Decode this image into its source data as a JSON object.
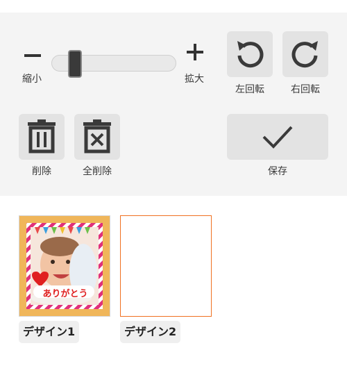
{
  "zoom": {
    "minus_symbol": "−",
    "plus_symbol": "+",
    "shrink_label": "縮小",
    "enlarge_label": "拡大",
    "level": 0.15
  },
  "rotate": {
    "left_label": "左回転",
    "right_label": "右回転"
  },
  "actions": {
    "delete_label": "削除",
    "delete_all_label": "全削除",
    "save_label": "保存"
  },
  "designs": [
    {
      "label": "デザイン1",
      "caption": "ありがとう",
      "selected": false
    },
    {
      "label": "デザイン2",
      "caption": "",
      "selected": true
    }
  ],
  "colors": {
    "toolbar_bg": "#f4f4f4",
    "button_bg": "#e3e3e3",
    "icon_color": "#3a3a3a",
    "selected_border": "#f07020",
    "thumb_bg": "#f0b65a",
    "frame_pink": "#e0307a",
    "heart_red": "#e02020"
  },
  "icons": [
    "minus-icon",
    "plus-icon",
    "rotate-left-icon",
    "rotate-right-icon",
    "trash-icon",
    "trash-x-icon",
    "checkmark-icon"
  ]
}
